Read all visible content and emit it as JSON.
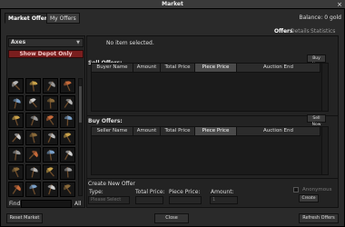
{
  "window": {
    "title": "Market",
    "close_glyph": "×"
  },
  "tabs": [
    {
      "label": "Market Offers",
      "active": true
    },
    {
      "label": "My Offers",
      "active": false
    }
  ],
  "balance": "Balance: 0 gold",
  "subtabs": [
    {
      "label": "Offers",
      "active": true
    },
    {
      "label": "Details",
      "active": false
    },
    {
      "label": "Statistics",
      "active": false
    }
  ],
  "left": {
    "category": "Axes",
    "depot_button": "Show Depot Only",
    "find_label": "Find:",
    "find_value": "",
    "all_label": "All",
    "item_icons": [
      "axe-icon",
      "axe-icon",
      "axe-icon",
      "axe-icon",
      "axe-icon",
      "axe-icon",
      "axe-icon",
      "axe-icon",
      "axe-icon",
      "axe-icon",
      "axe-icon",
      "axe-icon",
      "axe-icon",
      "axe-icon",
      "axe-icon",
      "axe-icon",
      "axe-icon",
      "axe-icon",
      "axe-icon",
      "axe-icon",
      "axe-icon",
      "axe-icon",
      "axe-icon",
      "axe-icon",
      "axe-icon",
      "axe-icon",
      "axe-icon",
      "axe-icon"
    ]
  },
  "right": {
    "no_item": "No item selected.",
    "sell_title": "Sell Offers:",
    "sell_button": "Buy Now",
    "sell_columns": [
      "Buyer Name",
      "Amount",
      "Total Price",
      "Piece Price",
      "Auction End"
    ],
    "buy_title": "Buy Offers:",
    "buy_button": "Sell Now",
    "buy_columns": [
      "Seller Name",
      "Amount",
      "Total Price",
      "Piece Price",
      "Auction End"
    ],
    "create": {
      "title": "Create New Offer",
      "type_label": "Type:",
      "type_value": "Please Select",
      "total_label": "Total Price:",
      "piece_label": "Piece Price:",
      "amount_label": "Amount:",
      "amount_value": "1",
      "anonymous_label": "Anonymous",
      "create_button": "Create"
    }
  },
  "footer": {
    "reset": "Reset Market",
    "close": "Close",
    "refresh": "Refresh Offers"
  },
  "colors": {
    "accent_red": "#7a1e1e",
    "background": "#2a2a2a"
  }
}
